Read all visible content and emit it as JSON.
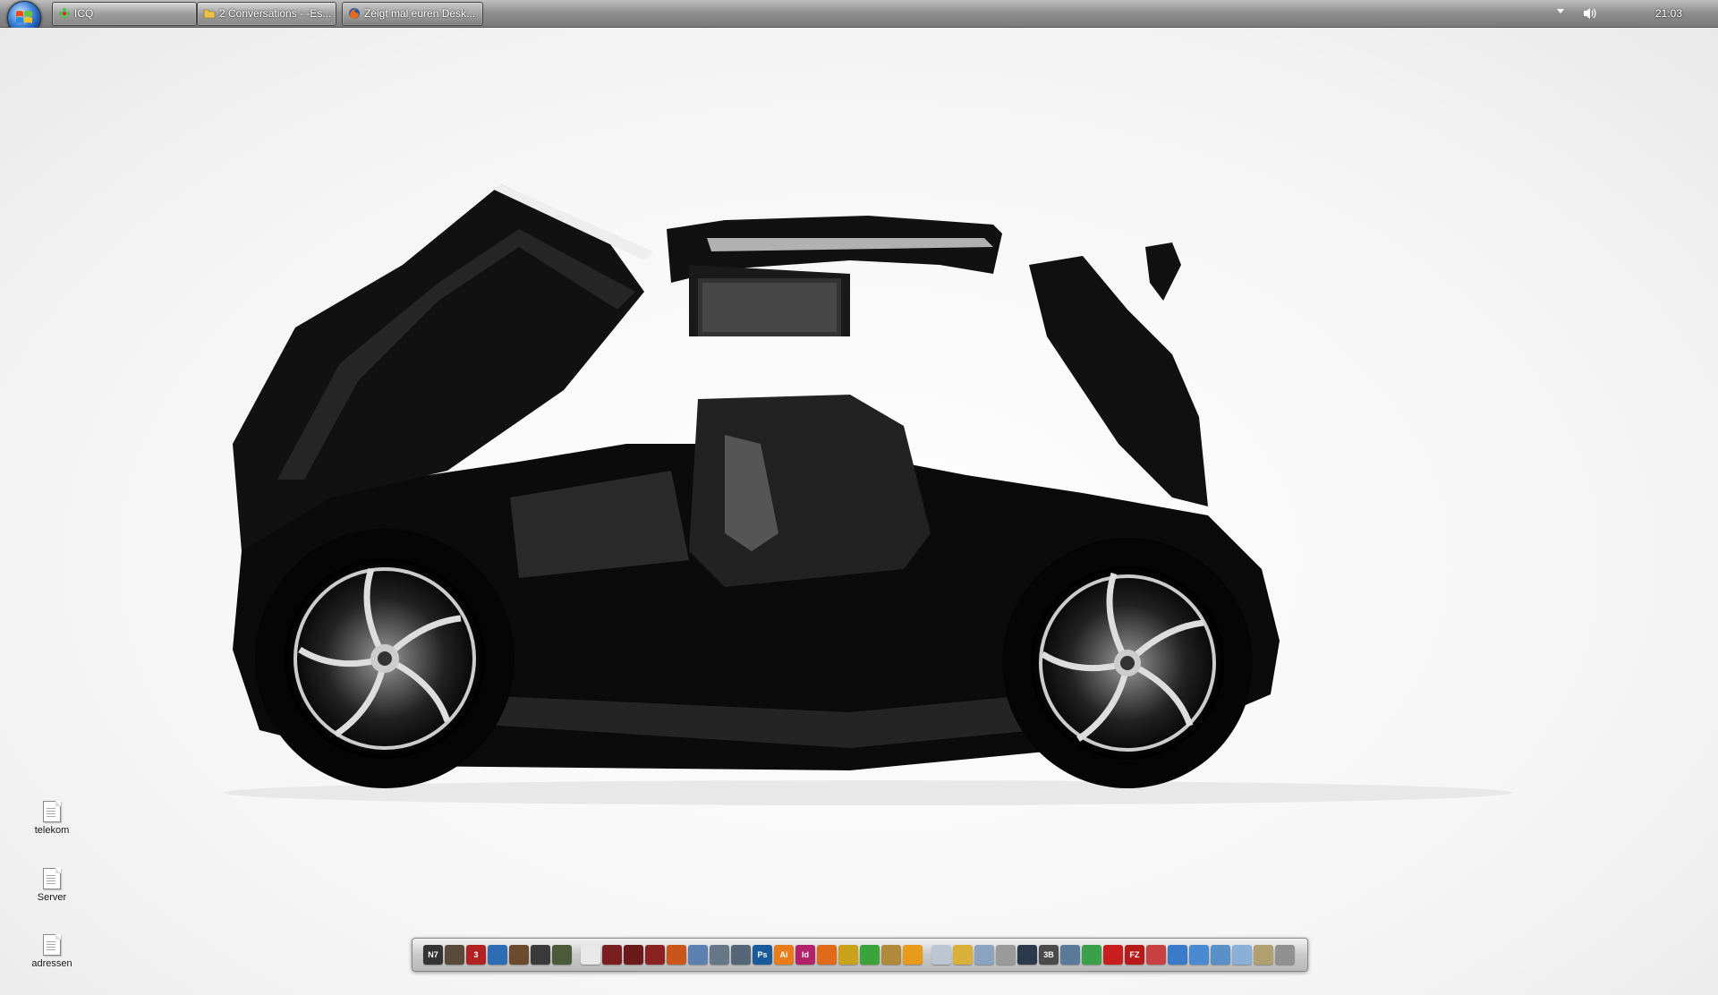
{
  "taskbar": {
    "tasks": [
      {
        "label": "ICQ",
        "icon": "icq-flower-icon"
      },
      {
        "label": "2 Conversations - -Es...",
        "icon": "folder-icon"
      },
      {
        "label": "Zeigt mal euren Desk...",
        "icon": "firefox-icon"
      }
    ],
    "clock": "21:03"
  },
  "desktop": {
    "icons": [
      {
        "label": "telekom",
        "icon": "text-file-icon"
      },
      {
        "label": "Server",
        "icon": "text-file-icon"
      },
      {
        "label": "adressen",
        "icon": "document-file-icon"
      }
    ]
  },
  "dock": {
    "apps": [
      {
        "name": "mass-effect-n7",
        "text": "N7",
        "color": "#333333"
      },
      {
        "name": "game-app",
        "text": "",
        "color": "#5a4a3a"
      },
      {
        "name": "game-3",
        "text": "3",
        "color": "#b22222"
      },
      {
        "name": "globe-app",
        "text": "",
        "color": "#2e6db4"
      },
      {
        "name": "game-app-2",
        "text": "",
        "color": "#6b4a2e"
      },
      {
        "name": "game-app-3",
        "text": "",
        "color": "#3a3a3a"
      },
      {
        "name": "world-of-tanks",
        "text": "",
        "color": "#4a5a3a"
      },
      {
        "name": "document-app",
        "text": "",
        "color": "#e8e8e8"
      },
      {
        "name": "plane-app",
        "text": "",
        "color": "#7a1f1f"
      },
      {
        "name": "plane-app-2",
        "text": "",
        "color": "#6a1a1a"
      },
      {
        "name": "plane-app-3",
        "text": "",
        "color": "#8a2222"
      },
      {
        "name": "orange-game",
        "text": "",
        "color": "#c8561a"
      },
      {
        "name": "network-app",
        "text": "",
        "color": "#5a7fb0"
      },
      {
        "name": "jet-app",
        "text": "",
        "color": "#667788"
      },
      {
        "name": "jet-app-2",
        "text": "",
        "color": "#556677"
      },
      {
        "name": "photoshop",
        "text": "Ps",
        "color": "#1a5a9a"
      },
      {
        "name": "illustrator",
        "text": "Ai",
        "color": "#e87b1a"
      },
      {
        "name": "indesign",
        "text": "Id",
        "color": "#b0226a"
      },
      {
        "name": "firefox",
        "text": "",
        "color": "#e06a1a"
      },
      {
        "name": "app-lightning",
        "text": "",
        "color": "#caa21a"
      },
      {
        "name": "icq",
        "text": "",
        "color": "#3aa33a"
      },
      {
        "name": "app-x",
        "text": "",
        "color": "#b08a3a"
      },
      {
        "name": "orange-ball",
        "text": "",
        "color": "#e89a1a"
      },
      {
        "name": "window-app",
        "text": "",
        "color": "#bcc6d0"
      },
      {
        "name": "folder-app",
        "text": "",
        "color": "#d8b03a"
      },
      {
        "name": "person-app",
        "text": "",
        "color": "#8aa4c0"
      },
      {
        "name": "mic-app",
        "text": "",
        "color": "#9a9a9a"
      },
      {
        "name": "steam",
        "text": "",
        "color": "#2a3a4a"
      },
      {
        "name": "ventrilo",
        "text": "3B",
        "color": "#4a4a4a"
      },
      {
        "name": "teamspeak",
        "text": "",
        "color": "#5a7a9a"
      },
      {
        "name": "utorrent",
        "text": "",
        "color": "#3aa04a"
      },
      {
        "name": "avira",
        "text": "",
        "color": "#c81e1e"
      },
      {
        "name": "filezilla",
        "text": "FZ",
        "color": "#b81a1a"
      },
      {
        "name": "pdf-app",
        "text": "",
        "color": "#c84040"
      },
      {
        "name": "sync-app",
        "text": "",
        "color": "#3a7ac8"
      },
      {
        "name": "globe-app-2",
        "text": "",
        "color": "#4a8ad0"
      },
      {
        "name": "network-app-2",
        "text": "",
        "color": "#5a90c8"
      },
      {
        "name": "mail-app",
        "text": "",
        "color": "#8ab0d8"
      },
      {
        "name": "tools-app",
        "text": "",
        "color": "#b0a070"
      },
      {
        "name": "settings-app",
        "text": "",
        "color": "#909090"
      }
    ]
  }
}
